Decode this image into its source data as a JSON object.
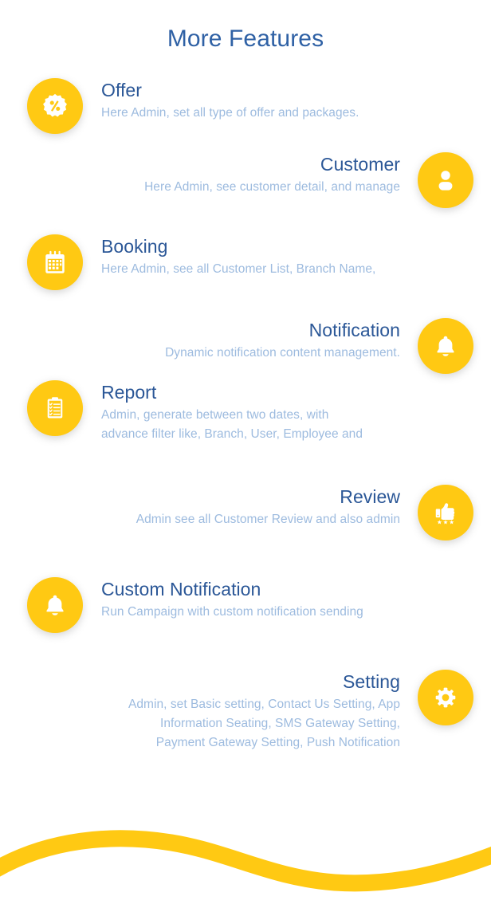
{
  "header": {
    "title": "More Features"
  },
  "theme": {
    "accent_yellow": "#ffc913",
    "title_blue": "#2f61a5",
    "heading_blue": "#2b5797",
    "body_blue": "#9dbbdf",
    "background": "#ffffff"
  },
  "features": [
    {
      "title": "Offer",
      "description": "Here Admin, set all type of offer and packages.",
      "icon": "percent-badge-icon",
      "align": "left"
    },
    {
      "title": "Customer",
      "description": "Here Admin, see customer detail, and manage",
      "icon": "person-icon",
      "align": "right"
    },
    {
      "title": "Booking",
      "description": "Here Admin, see all Customer List, Branch Name,",
      "icon": "calendar-icon",
      "align": "left"
    },
    {
      "title": "Notification",
      "description": "Dynamic notification content management.",
      "icon": "bell-icon",
      "align": "right"
    },
    {
      "title": "Report",
      "description": "Admin, generate between two dates, with\nadvance filter like, Branch, User, Employee and",
      "icon": "clipboard-checklist-icon",
      "align": "left"
    },
    {
      "title": "Review",
      "description": "Admin see all Customer Review and also admin",
      "icon": "thumbs-up-stars-icon",
      "align": "right"
    },
    {
      "title": "Custom Notification",
      "description": "Run Campaign with custom notification sending",
      "icon": "bell-icon",
      "align": "left"
    },
    {
      "title": "Setting",
      "description": "Admin, set Basic setting, Contact Us Setting, App\nInformation Seating, SMS Gateway  Setting,\nPayment Gateway Setting, Push Notification",
      "icon": "gear-icon",
      "align": "right"
    }
  ],
  "decoration": {
    "wave_label": "yellow-wave-divider"
  }
}
